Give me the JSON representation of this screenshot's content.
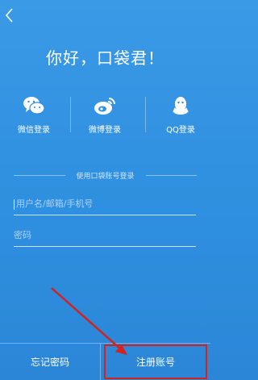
{
  "header": {
    "title": "你好，口袋君！"
  },
  "social": [
    {
      "label": "微信登录",
      "icon": "wechat-icon"
    },
    {
      "label": "微博登录",
      "icon": "weibo-icon"
    },
    {
      "label": "QQ登录",
      "icon": "qq-icon"
    }
  ],
  "divider": {
    "text": "使用口袋账号登录"
  },
  "form": {
    "username_placeholder": "用户名/邮箱/手机号",
    "password_placeholder": "密码"
  },
  "footer": {
    "forgot_label": "忘记密码",
    "register_label": "注册账号"
  },
  "colors": {
    "background": "#2f8fe0",
    "annotation": "#d4221c"
  }
}
